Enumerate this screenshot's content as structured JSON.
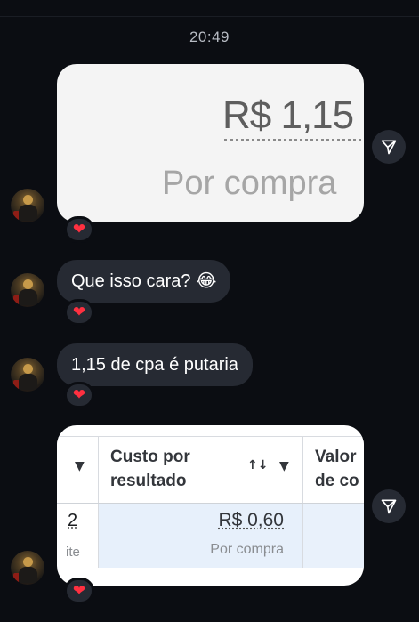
{
  "chat": {
    "timestamp": "20:49",
    "message_1": {
      "type": "image",
      "image_price": "R$ 1,15",
      "image_caption": "Por compra",
      "reaction": "❤"
    },
    "message_2": {
      "type": "text",
      "text": "Que isso cara? 😂",
      "reaction": "❤"
    },
    "message_3": {
      "type": "text",
      "text": "1,15 de cpa é putaria",
      "reaction": "❤"
    },
    "message_4": {
      "type": "image",
      "col_custo_header": "Custo por resultado",
      "col_custo_line1": "Custo por",
      "col_custo_line2": "resultado",
      "col_valor_line1": "Valor",
      "col_valor_line2": "de co",
      "sort_icon": "↑↓",
      "left_value": "2",
      "left_sub": "ite",
      "row_price": "R$ 0,60",
      "row_caption": "Por compra",
      "reaction": "❤"
    }
  },
  "icons": {
    "share": "send-icon",
    "reaction": "heart-icon",
    "dropdown": "caret-down-icon"
  },
  "colors": {
    "background": "#0b0d12",
    "bubble": "#262a33",
    "heart": "#ff3040",
    "timestamp": "#b7bbc3"
  }
}
